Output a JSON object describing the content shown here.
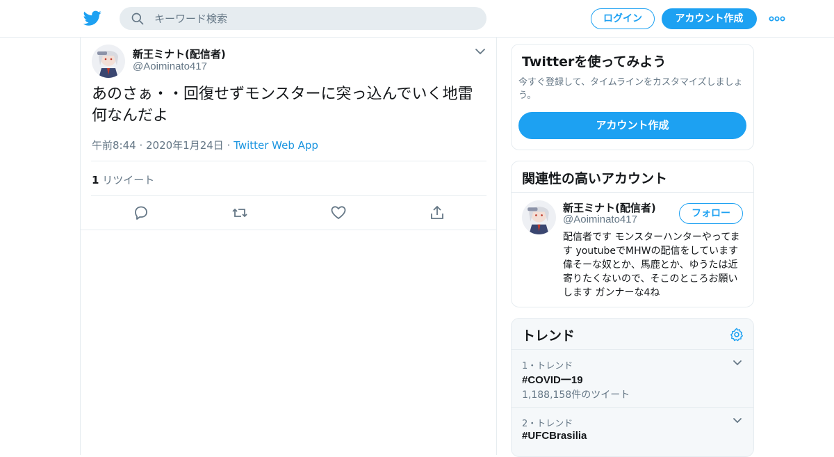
{
  "header": {
    "search_placeholder": "キーワード検索",
    "login_label": "ログイン",
    "signup_label": "アカウント作成"
  },
  "tweet": {
    "author_name": "新王ミナト(配信者)",
    "author_handle": "@Aoiminato417",
    "text": "あのさぁ・・回復せずモンスターに突っ込んでいく地雷何なんだよ",
    "timestamp": "午前8:44 · 2020年1月24日",
    "separator": "·",
    "source": "Twitter Web App",
    "retweet_count": "1",
    "retweet_label": "リツイート"
  },
  "signup_card": {
    "title": "Twitterを使ってみよう",
    "description": "今すぐ登録して、タイムラインをカスタマイズしましょう。",
    "button_label": "アカウント作成"
  },
  "related_card": {
    "title": "関連性の高いアカウント",
    "name": "新王ミナト(配信者)",
    "handle": "@Aoiminato417",
    "follow_label": "フォロー",
    "bio": "配信者です モンスターハンターやってます youtubeでMHWの配信をしています 偉そーな奴とか、馬鹿とか、ゆうたは近寄りたくないので、そこのところお願いします ガンナーな4ね"
  },
  "trends_card": {
    "title": "トレンド",
    "items": [
      {
        "rank": "1・トレンド",
        "tag": "#COVID一19",
        "count": "1,188,158件のツイート"
      },
      {
        "rank": "2・トレンド",
        "tag": "#UFCBrasilia",
        "count": ""
      }
    ]
  },
  "colors": {
    "accent": "#1da1f2",
    "link": "#1b95e0",
    "muted": "#657786",
    "border": "#e6ecf0"
  }
}
